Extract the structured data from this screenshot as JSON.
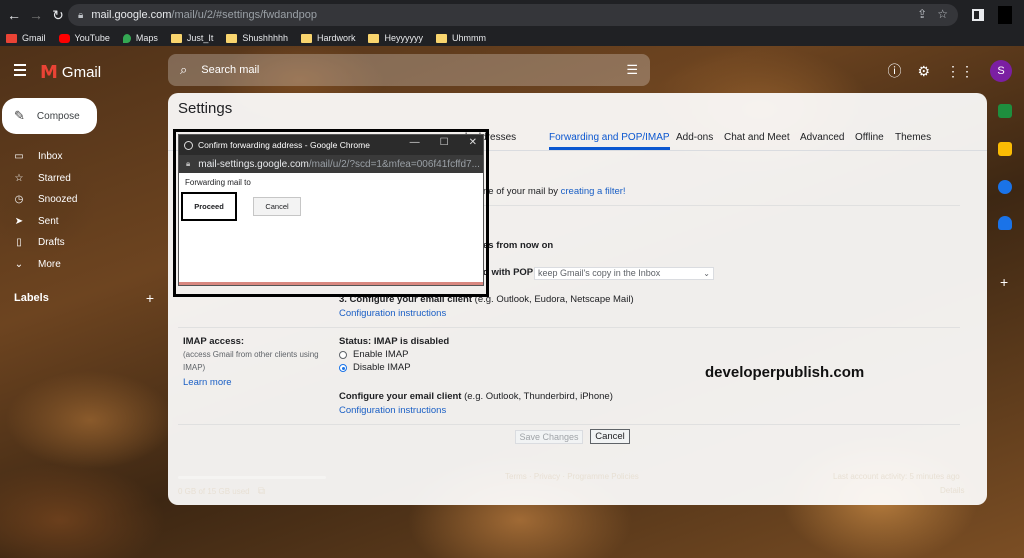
{
  "browser": {
    "url_host": "mail.google.com",
    "url_path": "/mail/u/2/#settings/fwdandpop",
    "icons": [
      "back-icon",
      "forward-icon",
      "reload-icon",
      "lock-icon",
      "share-icon",
      "star-icon"
    ]
  },
  "bookmarks": [
    {
      "label": "Gmail",
      "color": "#ea4335"
    },
    {
      "label": "YouTube",
      "color": "#ff0000"
    },
    {
      "label": "Maps",
      "color": "#34a853"
    },
    {
      "label": "Just_It",
      "color": "#f9d56e"
    },
    {
      "label": "Shushhhhh",
      "color": "#f9d56e"
    },
    {
      "label": "Hardwork",
      "color": "#f9d56e"
    },
    {
      "label": "Heyyyyyy",
      "color": "#f9d56e"
    },
    {
      "label": "Uhmmm",
      "color": "#f9d56e"
    }
  ],
  "gmail": {
    "app_name": "Gmail",
    "search_placeholder": "Search mail",
    "avatar_initial": "S",
    "compose_label": "Compose",
    "nav": [
      {
        "label": "Inbox",
        "icon": "inbox-icon",
        "glyph": "▭"
      },
      {
        "label": "Starred",
        "icon": "star-icon",
        "glyph": "☆"
      },
      {
        "label": "Snoozed",
        "icon": "clock-icon",
        "glyph": "◷"
      },
      {
        "label": "Sent",
        "icon": "send-icon",
        "glyph": "➤"
      },
      {
        "label": "Drafts",
        "icon": "draft-icon",
        "glyph": "▯"
      },
      {
        "label": "More",
        "icon": "chevron-down-icon",
        "glyph": "⌄"
      }
    ],
    "labels_heading": "Labels"
  },
  "settings": {
    "title": "Settings",
    "tabs": [
      {
        "label": "l addresses",
        "active": false
      },
      {
        "label": "Forwarding and POP/IMAP",
        "active": true
      },
      {
        "label": "Add-ons",
        "active": false
      },
      {
        "label": "Chat and Meet",
        "active": false
      },
      {
        "label": "Advanced",
        "active": false
      },
      {
        "label": "Offline",
        "active": false
      },
      {
        "label": "Themes",
        "active": false
      }
    ],
    "filter_text_prefix": "ne of your mail by ",
    "filter_link": "creating a filter!",
    "pop_from_now": "es from now on",
    "pop_with": "d with POP",
    "pop_select_value": "keep Gmail's copy in the Inbox",
    "step3_bold": "3. Configure your email client",
    "step3_rest": " (e.g. Outlook, Eudora, Netscape Mail)",
    "config_link_1": "Configuration instructions",
    "imap_label": "IMAP access:",
    "imap_desc_1": "(access Gmail from other clients using",
    "imap_desc_2": "IMAP)",
    "learn_more": "Learn more",
    "imap_status": "Status: IMAP is disabled",
    "enable_imap": "Enable IMAP",
    "disable_imap": "Disable IMAP",
    "imap_client_bold": "Configure your email client",
    "imap_client_rest": " (e.g. Outlook, Thunderbird, iPhone)",
    "config_link_2": "Configuration instructions",
    "save_changes": "Save Changes",
    "cancel": "Cancel",
    "watermark": "developerpublish.com"
  },
  "footer": {
    "storage": "0 GB of 15 GB used",
    "links": "Terms · Privacy · Programme Policies",
    "last_activity": "Last account activity: 5 minutes ago",
    "details": "Details"
  },
  "popup": {
    "title": "Confirm forwarding address - Google Chrome",
    "url_host": "mail-settings.google.com",
    "url_rest": "/mail/u/2/?scd=1&mfea=006f41fcffd7...",
    "message": "Forwarding mail to",
    "proceed": "Proceed",
    "cancel": "Cancel",
    "controls": [
      "—",
      "☐",
      "✕"
    ]
  }
}
